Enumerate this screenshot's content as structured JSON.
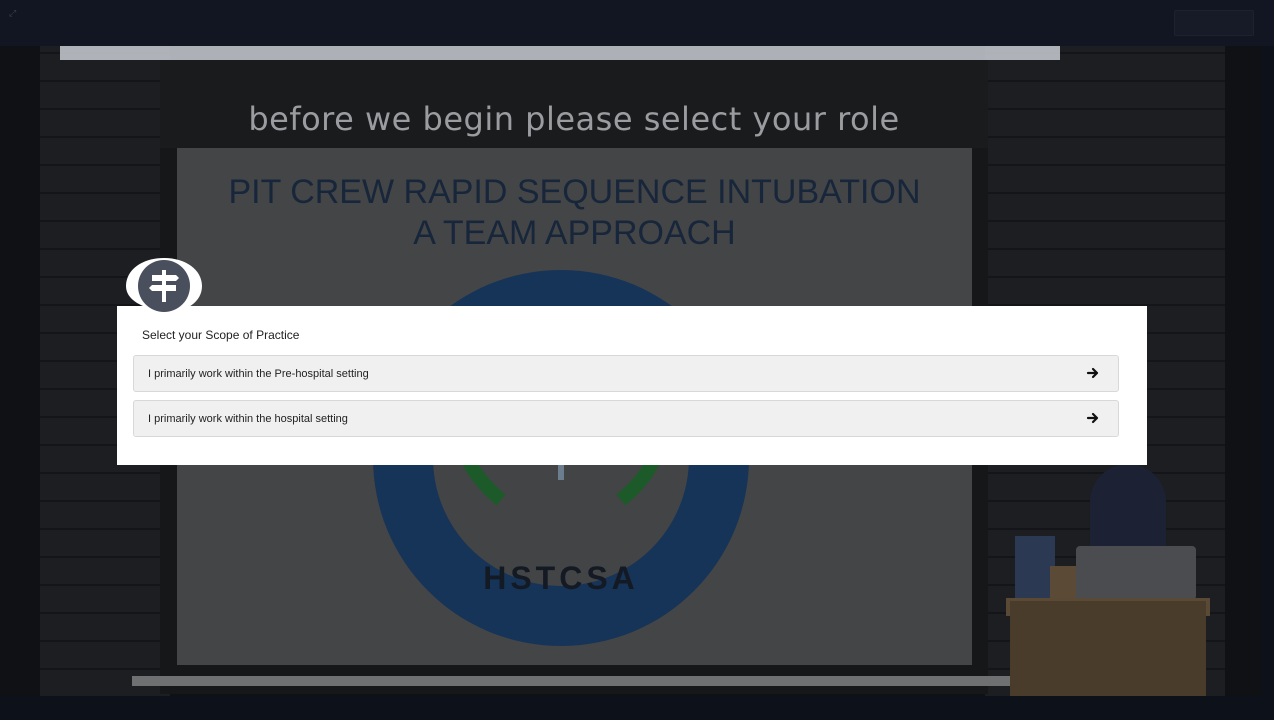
{
  "stage": {
    "headline": "before we begin please select your role",
    "screen_title_line1": "PIT CREW RAPID SEQUENCE INTUBATION",
    "screen_title_line2": "A TEAM APPROACH",
    "logo_text": "HSTCSA"
  },
  "modal": {
    "badge_icon": "signpost-icon",
    "question": "Select your Scope of Practice",
    "options": [
      {
        "label": "I primarily work within the Pre-hospital setting",
        "icon": "arrow-right-icon"
      },
      {
        "label": "I primarily work within the hospital setting",
        "icon": "arrow-right-icon"
      }
    ]
  },
  "colors": {
    "modal_bg": "#ffffff",
    "option_bg": "#f0f0f0",
    "badge": "#4a4f5e"
  }
}
